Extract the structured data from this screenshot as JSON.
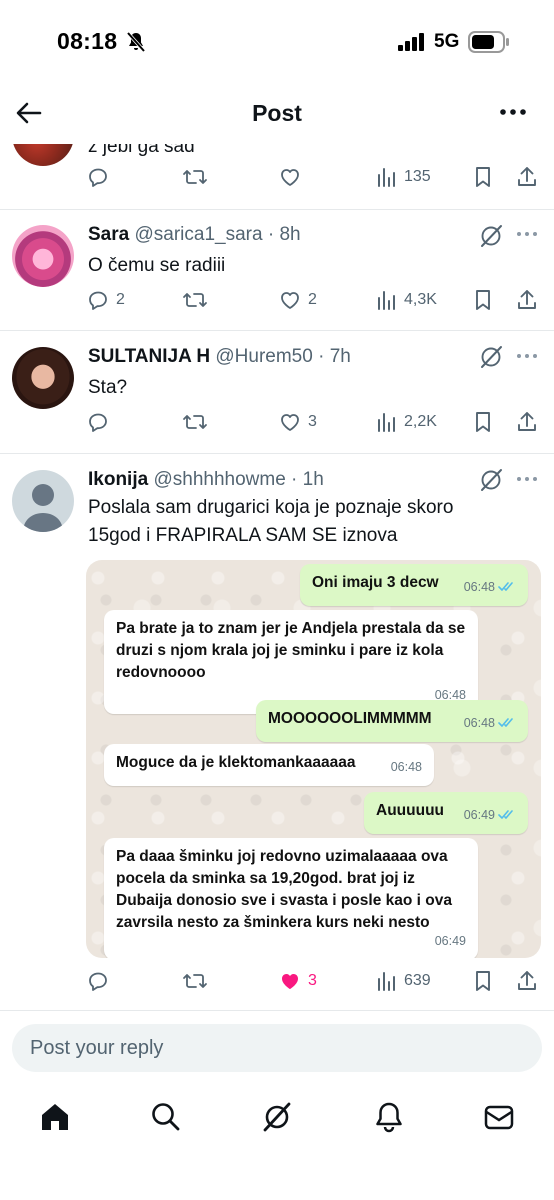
{
  "status_bar": {
    "time": "08:18",
    "network": "5G"
  },
  "header": {
    "title": "Post"
  },
  "partial_post": {
    "text": "z jebi ga sad",
    "views": "135"
  },
  "posts": [
    {
      "name": "Sara",
      "handle": "@sarica1_sara",
      "time": "8h",
      "text": "O čemu  se radiii",
      "replies": "2",
      "retweets": "",
      "likes": "2",
      "views": "4,3K"
    },
    {
      "name": "SULTANIJA H",
      "handle": "@Hurem50",
      "time": "7h",
      "text": "Sta?",
      "replies": "",
      "retweets": "",
      "likes": "3",
      "views": "2,2K"
    },
    {
      "name": "Ikonija",
      "handle": "@shhhhhowme",
      "time": "1h",
      "text": "Poslala sam drugarici koja je poznaje skoro 15god i FRAPIRALA SAM SE iznova",
      "replies": "",
      "retweets": "",
      "likes": "3",
      "views": "639"
    }
  ],
  "chat": {
    "messages": [
      {
        "dir": "out",
        "text": "Oni imaju 3 decw",
        "time": "06:48"
      },
      {
        "dir": "in",
        "text": "Pa brate ja to znam jer je Andjela prestala da se druzi s njom krala joj je sminku i pare iz kola redovnoooo",
        "time": "06:48"
      },
      {
        "dir": "out",
        "text": "MOOOOOOLIMMMMM",
        "time": "06:48"
      },
      {
        "dir": "in",
        "text": "Moguce da je klektomankaaaaaa",
        "time": "06:48"
      },
      {
        "dir": "out",
        "text": "Auuuuuu",
        "time": "06:49"
      },
      {
        "dir": "in",
        "text": "Pa daaa šminku joj redovno uzimalaaaaa ova pocela da sminka sa 19,20god. brat joj iz Dubaija donosio sve i svasta i posle kao i ova zavrsila nesto za šminkera kurs neki nesto",
        "time": "06:49"
      }
    ]
  },
  "reply_bar": {
    "placeholder": "Post your reply"
  },
  "colors": {
    "like_pink": "#f91880",
    "grey": "#536471",
    "wa_green": "#dcf8c6",
    "wa_tick": "#53bdeb"
  },
  "nav": [
    "home-icon",
    "search-icon",
    "grok-icon",
    "notifications-icon",
    "messages-icon"
  ]
}
